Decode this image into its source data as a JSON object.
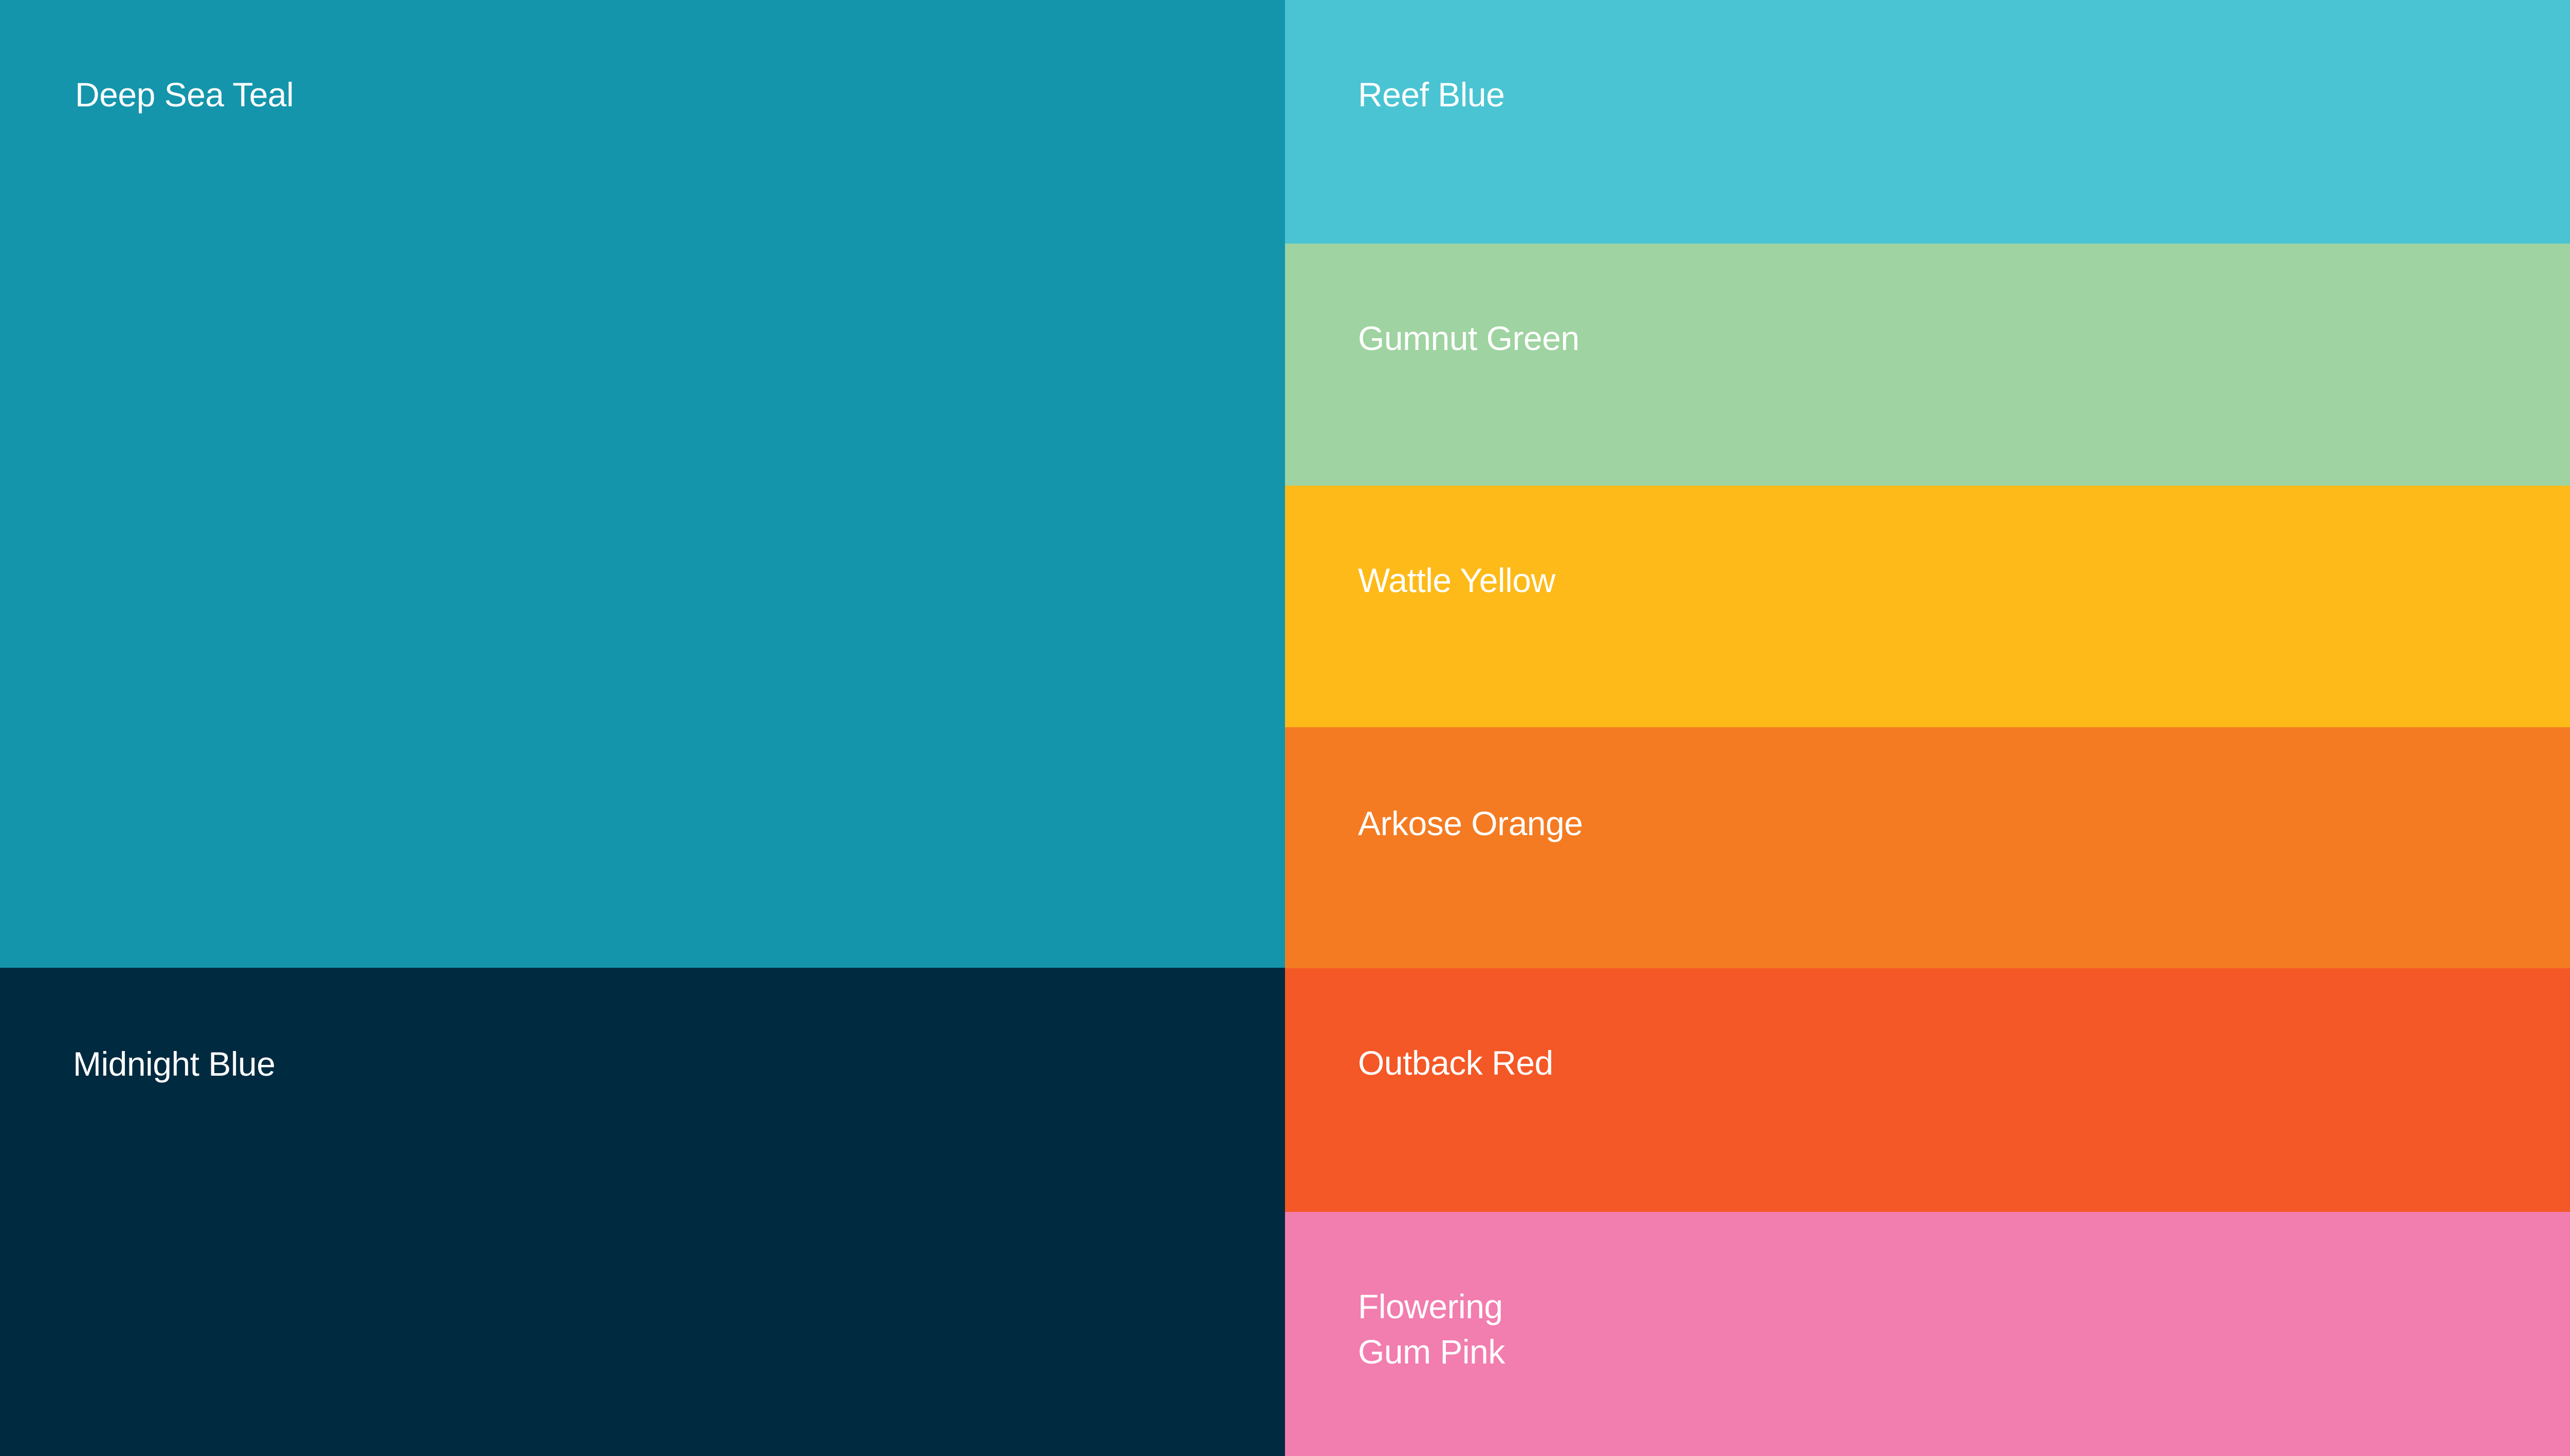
{
  "swatches": {
    "deep_sea_teal": {
      "name": "Deep Sea Teal",
      "color": "#1495ab"
    },
    "midnight_blue": {
      "name": "Midnight Blue",
      "color": "#002a40"
    },
    "reef_blue": {
      "name": "Reef Blue",
      "color": "#4ac4d2"
    },
    "gumnut_green": {
      "name": "Gumnut Green",
      "color": "#9fd3a1"
    },
    "wattle_yellow": {
      "name": "Wattle Yellow",
      "color": "#fdba18"
    },
    "arkose_orange": {
      "name": "Arkose Orange",
      "color": "#f47b22"
    },
    "outback_red": {
      "name": "Outback Red",
      "color": "#f35826"
    },
    "flowering_gum_pink": {
      "name": "Flowering\nGum Pink",
      "color": "#f27daf"
    }
  }
}
